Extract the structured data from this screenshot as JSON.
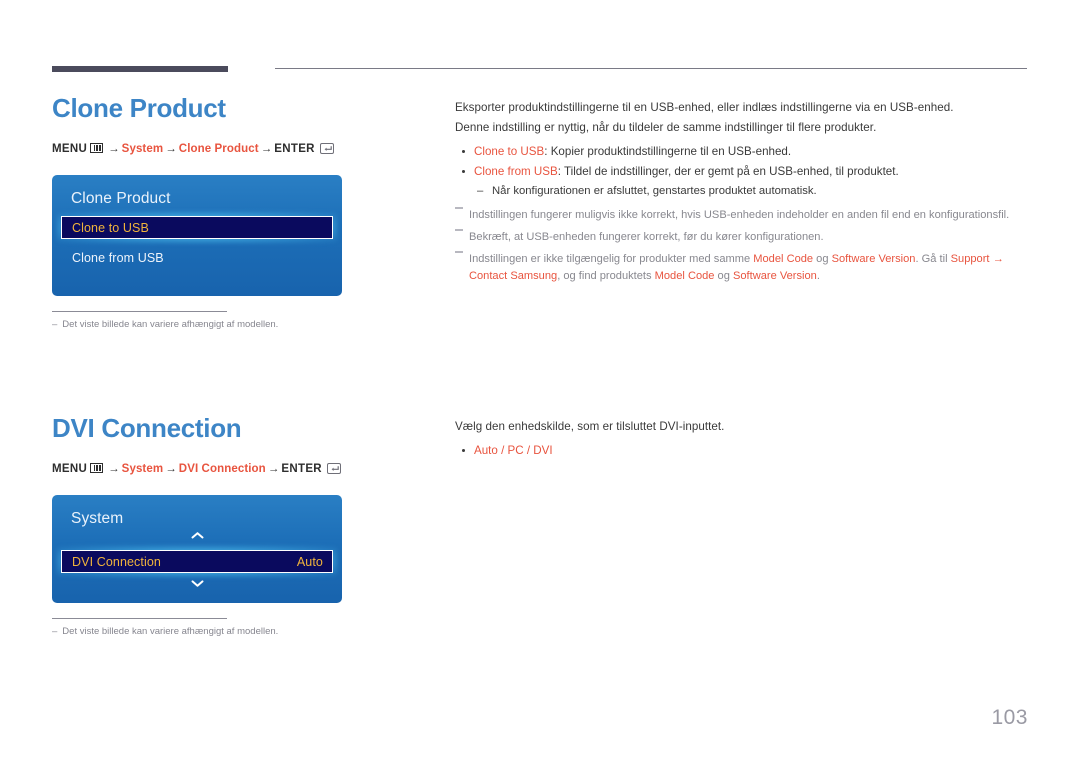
{
  "page": {
    "number": "103"
  },
  "sections": [
    {
      "title": "Clone Product",
      "menu_path": {
        "menu_label": "MENU",
        "menu_icon": "menu-icon",
        "step1": "System",
        "step2": "Clone Product",
        "enter_label": "ENTER",
        "enter_icon": "enter-icon",
        "arrow": "→"
      },
      "osd": {
        "title": "Clone Product",
        "selected": {
          "label": "Clone to USB",
          "value": ""
        },
        "items": [
          "Clone from USB"
        ]
      },
      "footnote": {
        "dash": "–",
        "text": "Det viste billede kan variere afhængigt af modellen."
      },
      "body": {
        "paragraphs": [
          "Eksporter produktindstillingerne til en USB-enhed, eller indlæs indstillingerne via en USB-enhed.",
          "Denne indstilling er nyttig, når du tildeler de samme indstillinger til flere produkter."
        ],
        "bullets": [
          {
            "accent": "Clone to USB",
            "rest": ": Kopier produktindstillingerne til en USB-enhed."
          },
          {
            "accent": "Clone from USB",
            "rest": ": Tildel de indstillinger, der er gemt på en USB-enhed, til produktet."
          }
        ],
        "sub_bullets": [
          {
            "dash": "–",
            "text": "Når konfigurationen er afsluttet, genstartes produktet automatisk."
          }
        ],
        "notes": [
          {
            "parts": [
              {
                "t": "Indstillingen fungerer muligvis ikke korrekt, hvis USB-enheden indeholder en anden fil end en konfigurationsfil.",
                "style": "plain"
              }
            ]
          },
          {
            "parts": [
              {
                "t": "Bekræft, at USB-enheden fungerer korrekt, før du kører konfigurationen.",
                "style": "plain"
              }
            ]
          },
          {
            "parts": [
              {
                "t": "Indstillingen er ikke tilgængelig for produkter med samme ",
                "style": "plain"
              },
              {
                "t": "Model Code",
                "style": "accent"
              },
              {
                "t": " og ",
                "style": "plain"
              },
              {
                "t": "Software Version",
                "style": "accent"
              },
              {
                "t": ". Gå til ",
                "style": "plain"
              },
              {
                "t": "Support",
                "style": "accent"
              },
              {
                "t": " → ",
                "style": "accent"
              },
              {
                "t": "Contact Samsung",
                "style": "accent"
              },
              {
                "t": ", og find produktets ",
                "style": "plain"
              },
              {
                "t": "Model Code",
                "style": "accent"
              },
              {
                "t": " og ",
                "style": "plain"
              },
              {
                "t": "Software Version",
                "style": "accent"
              },
              {
                "t": ".",
                "style": "plain"
              }
            ]
          }
        ]
      }
    },
    {
      "title": "DVI Connection",
      "menu_path": {
        "menu_label": "MENU",
        "menu_icon": "menu-icon",
        "step1": "System",
        "step2": "DVI Connection",
        "enter_label": "ENTER",
        "enter_icon": "enter-icon",
        "arrow": "→"
      },
      "osd": {
        "title": "System",
        "selected": {
          "label": "DVI Connection",
          "value": "Auto"
        },
        "items": []
      },
      "footnote": {
        "dash": "–",
        "text": "Det viste billede kan variere afhængigt af modellen."
      },
      "body": {
        "paragraphs": [
          "Vælg den enhedskilde, som er tilsluttet DVI-inputtet."
        ],
        "bullets": [
          {
            "accent": "Auto / PC / DVI",
            "rest": ""
          }
        ],
        "sub_bullets": [],
        "notes": []
      }
    }
  ],
  "colors": {
    "heading": "#3d85c6",
    "accent": "#e8543f",
    "osd_blue": "#1d6fb8",
    "osd_selected_bg": "#0a0a5e",
    "osd_selected_text": "#f0b43c",
    "note_gray": "#88888f",
    "header_bar": "#4b4b5c"
  }
}
